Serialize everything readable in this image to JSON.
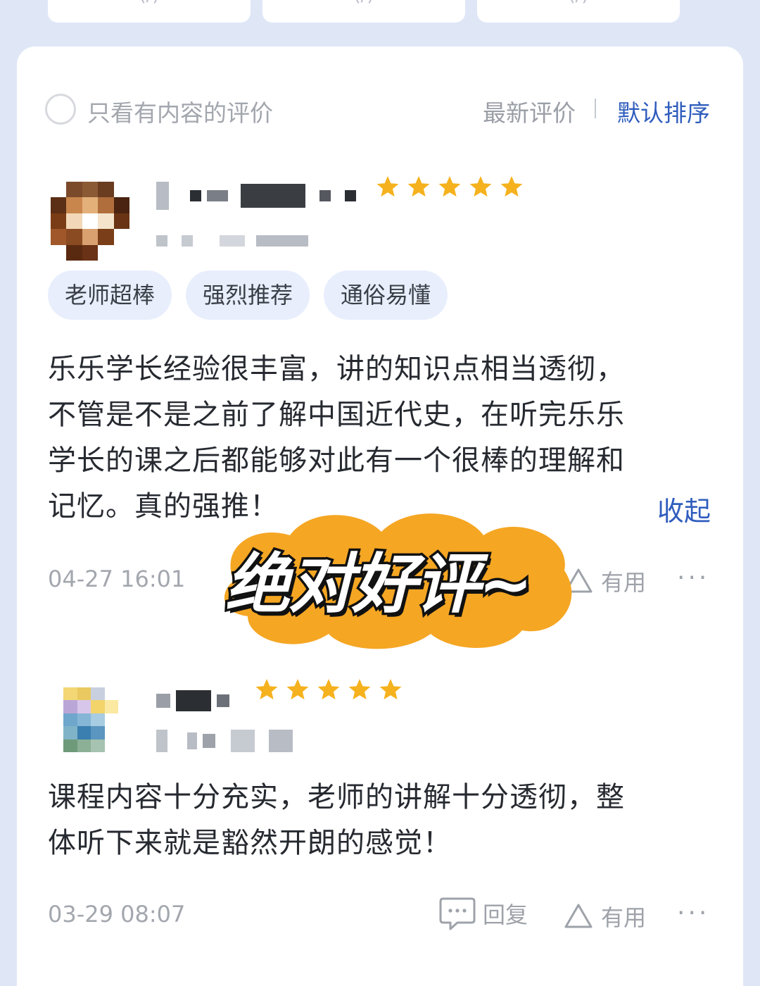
{
  "top_cards": [
    "(/)",
    "(/)",
    "(/)"
  ],
  "filter": {
    "only_with_content_label": "只看有内容的评价",
    "sort_newest_label": "最新评价",
    "sort_default_label": "默认排序"
  },
  "reviews": [
    {
      "rating": 5,
      "tags": [
        "老师超棒",
        "强烈推荐",
        "通俗易懂"
      ],
      "text_lines": [
        "乐乐学长经验很丰富，讲的知识点相当透彻，",
        "不管是不是之前了解中国近代史，在听完乐乐",
        "学长的课之后都能够对此有一个很棒的理解和",
        "记忆。真的强推！"
      ],
      "collapse_label": "收起",
      "time": "04-27 16:01",
      "useful_label": "有用",
      "more_label": "···"
    },
    {
      "rating": 5,
      "text_lines": [
        "课程内容十分充实，老师的讲解十分透彻，整",
        "体听下来就是豁然开朗的感觉！"
      ],
      "time": "03-29 08:07",
      "reply_label": "回复",
      "useful_label": "有用",
      "more_label": "···"
    }
  ],
  "sticker": {
    "text": "绝对好评~",
    "color": "#f5a623"
  },
  "colors": {
    "accent": "#2f5dbd",
    "star": "#f5b21e",
    "tag_bg": "#e8eefc"
  }
}
